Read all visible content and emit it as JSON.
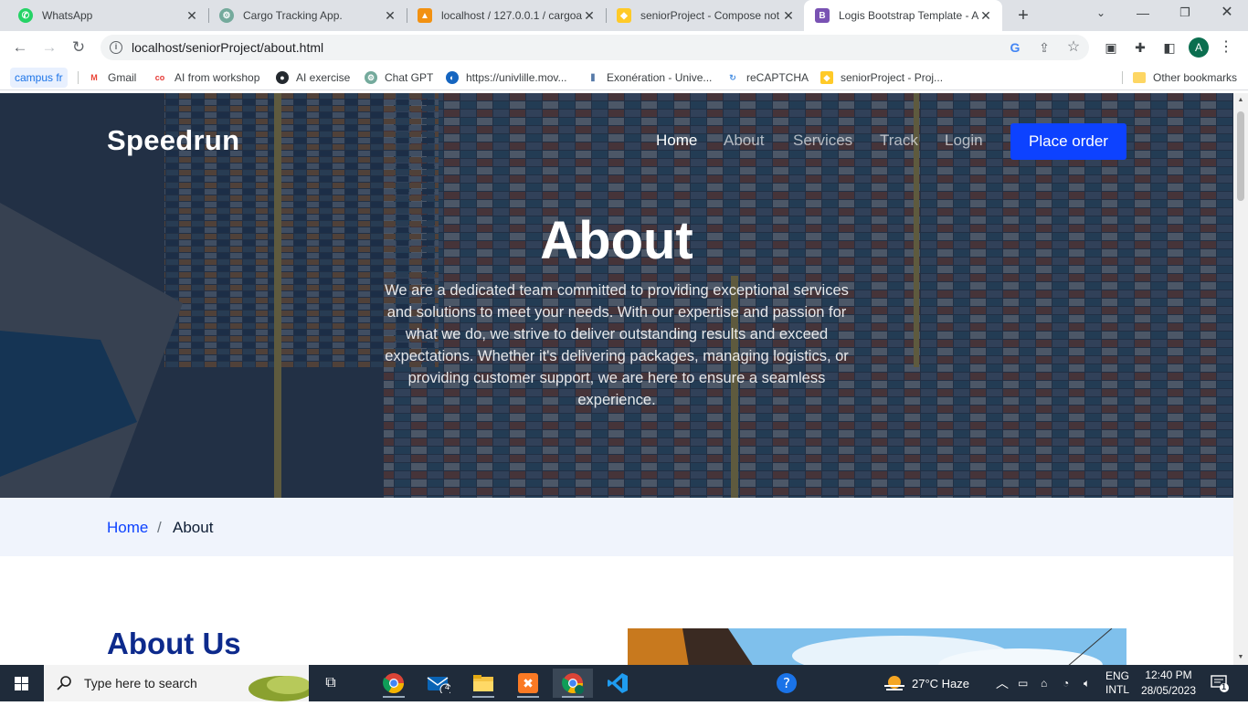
{
  "browser": {
    "tabs": [
      {
        "title": "WhatsApp",
        "favicon": "whatsapp-icon",
        "color": "#25d366",
        "active": false
      },
      {
        "title": "Cargo Tracking App.",
        "favicon": "chatgpt-icon",
        "color": "#74aa9c",
        "active": false
      },
      {
        "title": "localhost / 127.0.0.1 / cargoa",
        "favicon": "phpmyadmin-icon",
        "color": "#f29111",
        "active": false
      },
      {
        "title": "seniorProject - Compose not",
        "favicon": "firebase-icon",
        "color": "#ffca28",
        "active": false
      },
      {
        "title": "Logis Bootstrap Template - A",
        "favicon": "bootstrap-icon",
        "color": "#7952b3",
        "active": true
      }
    ],
    "url": "localhost/seniorProject/about.html",
    "avatar_letter": "A",
    "bookmarks": [
      {
        "label": "campus fr"
      },
      {
        "label": "Gmail"
      },
      {
        "label": "AI from workshop"
      },
      {
        "label": "AI exercise"
      },
      {
        "label": "Chat GPT"
      },
      {
        "label": "https://univlille.mov..."
      },
      {
        "label": "Exonération - Unive..."
      },
      {
        "label": "reCAPTCHA"
      },
      {
        "label": "seniorProject - Proj..."
      }
    ],
    "other_bookmarks": "Other bookmarks"
  },
  "site": {
    "brand": "Speedrun",
    "nav": [
      {
        "label": "Home",
        "active": true
      },
      {
        "label": "About",
        "active": false
      },
      {
        "label": "Services",
        "active": false
      },
      {
        "label": "Track",
        "active": false
      },
      {
        "label": "Login",
        "active": false
      }
    ],
    "cta": "Place order",
    "hero": {
      "title": "About",
      "text": "We are a dedicated team committed to providing exceptional services and solutions to meet your needs. With our expertise and passion for what we do, we strive to deliver outstanding results and exceed expectations. Whether it's delivering packages, managing logistics, or providing customer support, we are here to ensure a seamless experience."
    },
    "breadcrumb": {
      "home": "Home",
      "separator": "/",
      "current": "About"
    },
    "about_title": "About Us",
    "accent": "#0d42ff"
  },
  "taskbar": {
    "search_placeholder": "Type here to search",
    "weather": "27°C  Haze",
    "lang_line1": "ENG",
    "lang_line2": "INTL",
    "time": "12:40 PM",
    "date": "28/05/2023",
    "mail_badge": "4",
    "notification_count": "1"
  }
}
